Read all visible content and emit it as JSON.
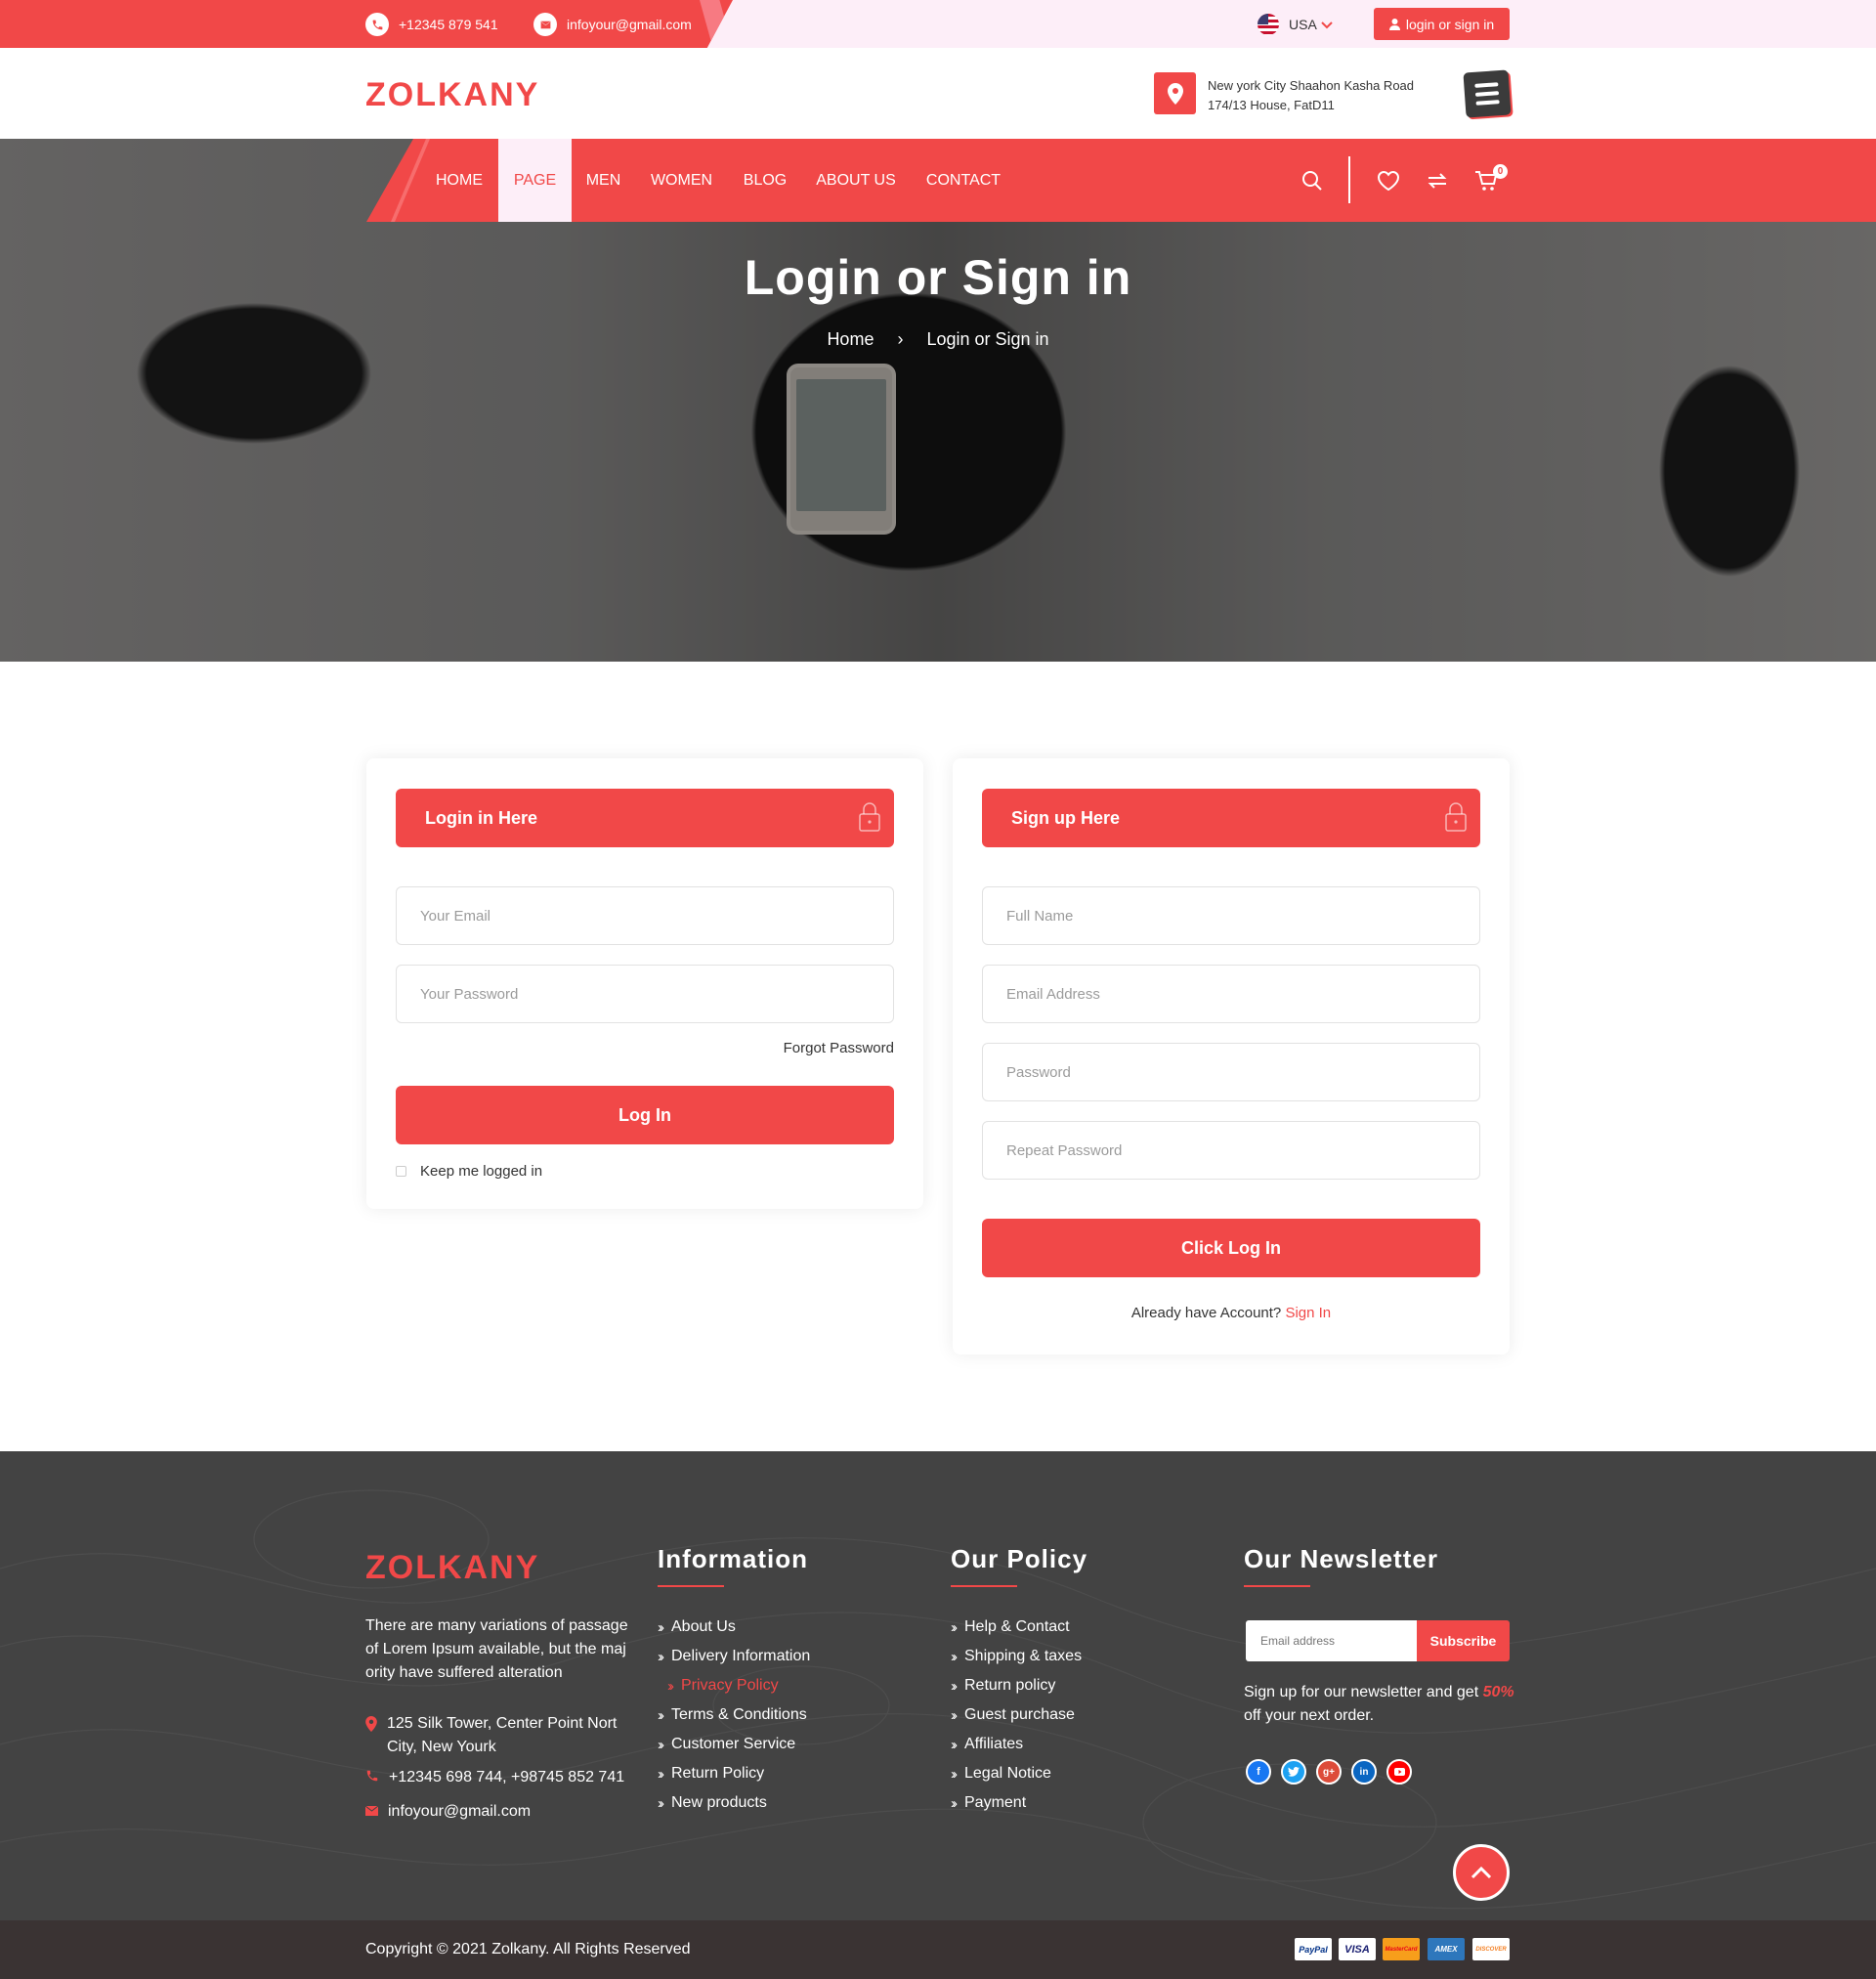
{
  "topbar": {
    "phone": "+12345 879 541",
    "email": "infoyour@gmail.com",
    "country": "USA",
    "login_label": "login or sign in"
  },
  "header": {
    "logo": "ZOLKANY",
    "address_line1": "New york City Shaahon Kasha Road",
    "address_line2": "174/13 House, FatD11"
  },
  "nav": {
    "items": [
      "HOME",
      "PAGE",
      "MEN",
      "WOMEN",
      "BLOG",
      "ABOUT US",
      "CONTACT"
    ],
    "active": "PAGE",
    "cart_count": "0"
  },
  "hero": {
    "title": "Login or Sign in",
    "breadcrumb_home": "Home",
    "breadcrumb_separator": "›",
    "breadcrumb_current": "Login or Sign in"
  },
  "login": {
    "heading": "Login in Here",
    "email_placeholder": "Your Email",
    "password_placeholder": "Your Password",
    "forgot": "Forgot Password",
    "button": "Log In",
    "remember": "Keep me logged in"
  },
  "signup": {
    "heading": "Sign up Here",
    "name_placeholder": "Full Name",
    "email_placeholder": "Email Address",
    "password_placeholder": "Password",
    "repeat_placeholder": "Repeat Password",
    "button": "Click Log In",
    "already": "Already have Account?",
    "signin_link": "Sign In"
  },
  "footer": {
    "logo": "ZOLKANY",
    "about": "There are many variations of passage of Lorem Ipsum available, but the maj ority have suffered alteration",
    "address": "125 Silk Tower, Center Point Nort City, New Yourk",
    "phones": "+12345 698 744, +98745 852 741",
    "email": "infoyour@gmail.com",
    "info_heading": "Information",
    "info_links": [
      "About Us",
      "Delivery Information",
      "Privacy Policy",
      "Terms & Conditions",
      "Customer Service",
      "Return Policy",
      "New products"
    ],
    "policy_heading": "Our Policy",
    "policy_links": [
      "Help & Contact",
      "Shipping & taxes",
      "Return policy",
      "Guest purchase",
      "Affiliates",
      "Legal Notice",
      "Payment"
    ],
    "newsletter_heading": "Our Newsletter",
    "newsletter_placeholder": "Email address",
    "subscribe": "Subscribe",
    "newsletter_text": "Sign up for our newsletter and get",
    "newsletter_percent": "50%",
    "newsletter_text2": "off your next order.",
    "social_icons": [
      "facebook-icon",
      "twitter-icon",
      "google-plus-icon",
      "linkedin-icon",
      "youtube-icon"
    ],
    "copyright": "Copyright © 2021 Zolkany. All Rights Reserved",
    "payments": [
      "PayPal",
      "VISA",
      "MasterCard",
      "AMEX",
      "DISCOVER"
    ]
  },
  "colors": {
    "accent": "#f14848",
    "topbar_bg": "#fdeef8",
    "footer_bg": "#434343",
    "copyright_bg": "#3a3333"
  }
}
